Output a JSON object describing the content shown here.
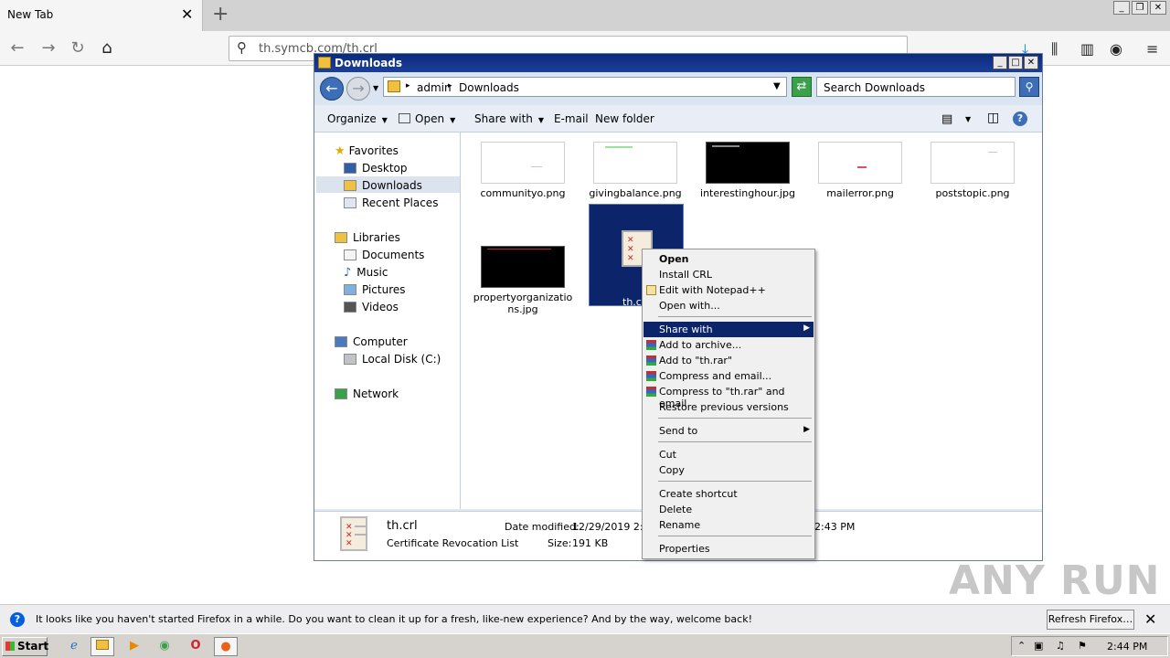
{
  "firefox": {
    "tab_title": "New Tab",
    "url": "th.symcb.com/th.crl",
    "notification": {
      "text": "It looks like you haven't started Firefox in a while. Do you want to clean it up for a fresh, like-new experience? And by the way, welcome back!",
      "button": "Refresh Firefox…"
    }
  },
  "explorer": {
    "title": "Downloads",
    "breadcrumb": [
      "admin",
      "Downloads"
    ],
    "search_placeholder": "Search Downloads",
    "commands": {
      "organize": "Organize",
      "open": "Open",
      "share_with": "Share with",
      "email": "E-mail",
      "new_folder": "New folder"
    },
    "nav": {
      "favorites": "Favorites",
      "desktop": "Desktop",
      "downloads": "Downloads",
      "recent_places": "Recent Places",
      "libraries": "Libraries",
      "documents": "Documents",
      "music": "Music",
      "pictures": "Pictures",
      "videos": "Videos",
      "computer": "Computer",
      "local_disk": "Local Disk (C:)",
      "network": "Network"
    },
    "files": [
      "communityo.png",
      "givingbalance.png",
      "interestinghour.jpg",
      "mailerror.png",
      "poststopic.png",
      "propertyorganizatio",
      "ns.jpg",
      "th.c"
    ],
    "details": {
      "name": "th.crl",
      "type": "Certificate Revocation List",
      "date_label": "Date modified:",
      "date_value": "12/29/2019 2:4",
      "size_label": "Size:",
      "size_value": "191 KB",
      "created_tail": "2:43 PM"
    }
  },
  "context_menu": {
    "open": "Open",
    "install_crl": "Install CRL",
    "edit_notepad": "Edit with Notepad++",
    "open_with": "Open with...",
    "share_with": "Share with",
    "add_archive": "Add to archive...",
    "add_rar": "Add to \"th.rar\"",
    "compress_email": "Compress and email...",
    "compress_rar_email": "Compress to \"th.rar\" and email",
    "restore": "Restore previous versions",
    "send_to": "Send to",
    "cut": "Cut",
    "copy": "Copy",
    "create_shortcut": "Create shortcut",
    "delete": "Delete",
    "rename": "Rename",
    "properties": "Properties"
  },
  "taskbar": {
    "start": "Start",
    "clock": "2:44 PM"
  },
  "watermark": "ANY RUN"
}
